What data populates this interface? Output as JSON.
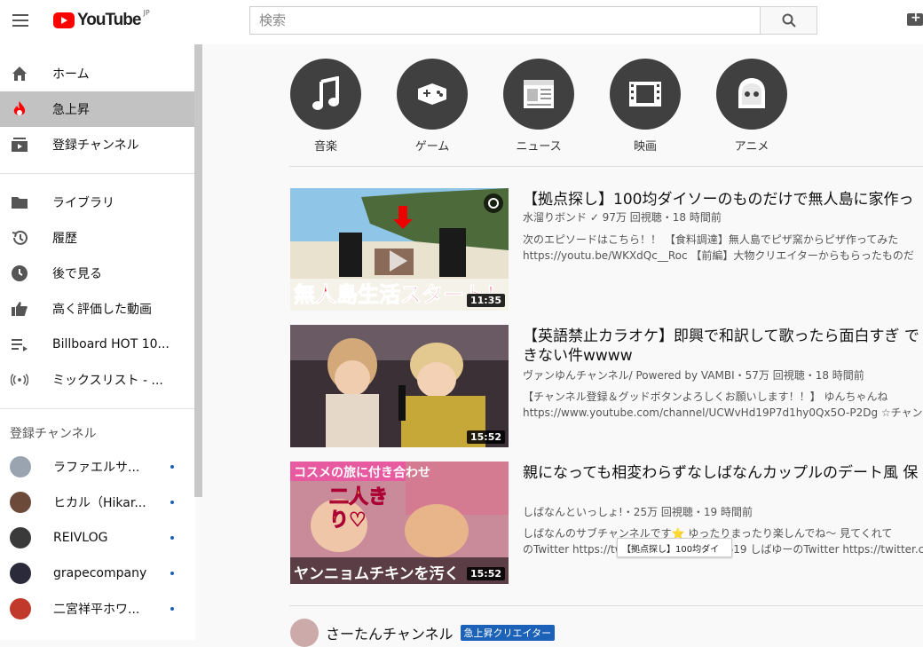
{
  "header": {
    "logo_text": "YouTube",
    "region": "JP",
    "search_placeholder": "検索"
  },
  "sidebar": {
    "primary": [
      {
        "label": "ホーム",
        "icon": "home-icon"
      },
      {
        "label": "急上昇",
        "icon": "trending-icon",
        "active": true
      },
      {
        "label": "登録チャンネル",
        "icon": "subscriptions-icon"
      }
    ],
    "library": [
      {
        "label": "ライブラリ",
        "icon": "folder-icon"
      },
      {
        "label": "履歴",
        "icon": "history-icon"
      },
      {
        "label": "後で見る",
        "icon": "clock-icon"
      },
      {
        "label": "高く評価した動画",
        "icon": "thumbs-up-icon"
      },
      {
        "label": "Billboard HOT 10...",
        "icon": "playlist-icon"
      },
      {
        "label": "ミックスリスト - ...",
        "icon": "mix-icon"
      }
    ],
    "subscriptions_title": "登録チャンネル",
    "subscriptions": [
      {
        "label": "ラファエルサ...",
        "color": "#9aa4b0"
      },
      {
        "label": "ヒカル（Hikar...",
        "color": "#6b4a3a"
      },
      {
        "label": "REIVLOG",
        "color": "#3a3a3a"
      },
      {
        "label": "grapecompany",
        "color": "#2a2a3a"
      },
      {
        "label": "二宮祥平ホワ...",
        "color": "#c0392b"
      }
    ],
    "accent_color": "#1c62b9"
  },
  "categories": [
    {
      "label": "音楽",
      "icon": "music-icon"
    },
    {
      "label": "ゲーム",
      "icon": "game-icon"
    },
    {
      "label": "ニュース",
      "icon": "news-icon"
    },
    {
      "label": "映画",
      "icon": "film-icon"
    },
    {
      "label": "アニメ",
      "icon": "anime-icon"
    }
  ],
  "videos": [
    {
      "title": "【拠点探し】100均ダイソーのものだけで無人島に家作っ",
      "meta": "水溜りボンド ✓ 97万 回視聴・18 時間前",
      "desc1": "次のエピソードはこちら！！ 【食料調達】無人島でピザ窯からピザ作ってみた",
      "desc2": "https://youtu.be/WKXdQc__Roc 【前編】大物クリエイターからもらったものだ",
      "duration": "11:35",
      "thumb_caption": "無人島生活スタート！"
    },
    {
      "title": "【英語禁止カラオケ】即興で和訳して歌ったら面白すぎ できない件wwww",
      "meta": "ヴァンゆんチャンネル/ Powered by VAMBI・57万 回視聴・18 時間前",
      "desc1": "【チャンネル登録＆グッドボタンよろしくお願いします！！】 ゆんちゃんね",
      "desc2": "https://www.youtube.com/channel/UCWvHd19P7d1hy0Qx5O-P2Dg ☆チャンネ",
      "duration": "15:52"
    },
    {
      "title": "親になっても相変わらずなしばなんカップルのデート風 保",
      "meta": "しばなんといっしょ!・25万 回視聴・19 時間前",
      "desc1": "しばなんのサブチャンネルです⭐ ゆったりまったり楽しんでね〜 見てくれて",
      "desc2": "のTwitter https://twitter.com/ayachan0619 しばゆーのTwitter https://twitter.co",
      "duration": "15:52",
      "thumb_caption_top": "コスメの旅に付き合わせ",
      "thumb_caption_mid": "二人きり♡",
      "thumb_caption_bottom": "ヤンニョムチキンを汚く"
    }
  ],
  "tooltip": "【拠点探し】100均ダイ",
  "shelf": {
    "channel": "さーたんチャンネル",
    "badge": "急上昇クリエイター"
  }
}
